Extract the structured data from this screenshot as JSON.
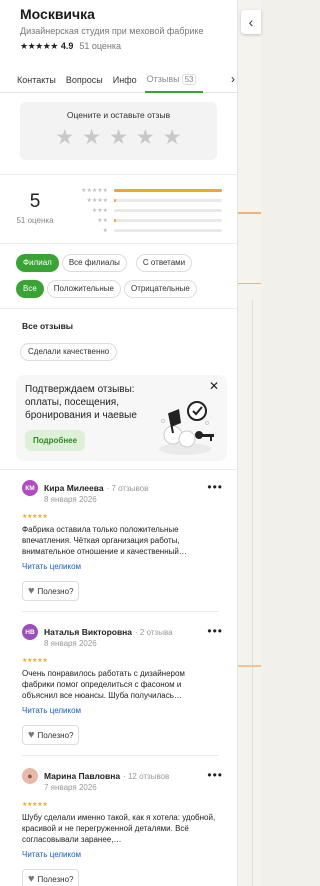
{
  "place": {
    "title": "Москвичка",
    "subtitle": "Дизайнерская студия при меховой фабрике",
    "stars": "★★★★★",
    "rating": "4.9",
    "rating_count": "51 оценка"
  },
  "tabs": [
    {
      "label": "Контакты"
    },
    {
      "label": "Вопросы"
    },
    {
      "label": "Инфо"
    },
    {
      "label": "Отзывы",
      "badge": "53"
    }
  ],
  "rate": {
    "title": "Оцените и оставьте отзыв"
  },
  "summary": {
    "rating": "5",
    "count": "51 оценка",
    "distribution": [
      {
        "stars": "★★★★★",
        "fraction": 1.0
      },
      {
        "stars": "★★★★",
        "fraction": 0.02
      },
      {
        "stars": "★★★",
        "fraction": 0.0
      },
      {
        "stars": "★★",
        "fraction": 0.02
      },
      {
        "stars": "★",
        "fraction": 0.0
      }
    ]
  },
  "filters": {
    "row1": [
      "Филиал",
      "Все филиалы",
      "С ответами"
    ],
    "row2": [
      "Все",
      "Положительные",
      "Отрицательные"
    ]
  },
  "reviews_section": {
    "title": "Все отзывы",
    "tag": "Сделали качественно"
  },
  "promo": {
    "text": "Подтверждаем отзывы: оплаты, посещения, бронирования и чаевые",
    "button": "Подробнее"
  },
  "reviews": [
    {
      "initials": "КМ",
      "avatar_color": "#b04ec0",
      "name": "Кира Милеева",
      "count": "· 7 отзывов",
      "date": "8 января 2026",
      "stars": "★★★★★",
      "text": "Фабрика оставила только положительные впечатления. Чёткая организация работы, внимательное отношение и качественный…",
      "link": "Читать целиком",
      "helpful": "Полезно?"
    },
    {
      "initials": "НВ",
      "avatar_color": "#9c4fb8",
      "name": "Наталья Викторовна",
      "count": "· 2 отзыва",
      "date": "8 января 2026",
      "stars": "★★★★★",
      "text": "Очень понравилось работать с дизайнером фабрики помог определиться с фасоном и объяснил все нюансы. Шуба получилась…",
      "link": "Читать целиком",
      "helpful": "Полезно?"
    },
    {
      "initials": "",
      "avatar_color": "#e8b9a8",
      "name": "Марина Павловна",
      "count": "· 12 отзывов",
      "date": "7 января 2026",
      "stars": "★★★★★",
      "text": "Шубу сделали именно такой, как я хотела: удобной, красивой и не перегруженной деталями. Всё согласовывали заранее,…",
      "link": "Читать целиком",
      "helpful": "Полезно?"
    }
  ]
}
